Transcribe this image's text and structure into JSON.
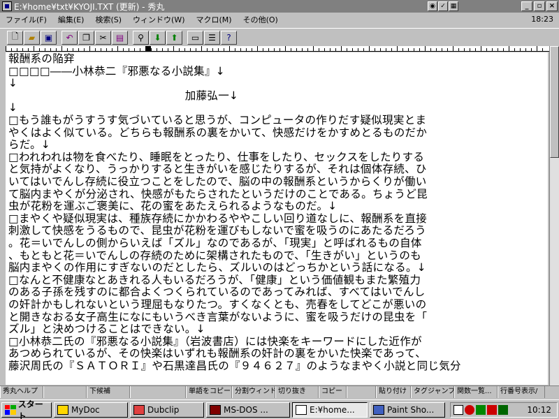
{
  "window": {
    "title": "E:¥home¥txt¥KYOJI.TXT (更新) - 秀丸",
    "tray_icons": [
      "globe-icon",
      "check-icon",
      "grid-icon"
    ],
    "minimize": "_",
    "restore": "▫",
    "close": "×"
  },
  "menu": {
    "items": [
      "ファイル(F)",
      "編集(E)",
      "検索(S)",
      "ウィンドウ(W)",
      "マクロ(M)",
      "その他(O)"
    ],
    "clock": "18:23"
  },
  "toolbar": {
    "buttons": [
      "new-file-icon",
      "open-file-icon",
      "save-icon",
      "undo-icon",
      "copy-icon",
      "cut-icon",
      "paste-icon",
      "search-icon",
      "search-down-icon",
      "search-up-icon",
      "tag-jump-icon",
      "split-window-icon",
      "help-icon"
    ]
  },
  "document": {
    "lines": [
      "報酬系の陥穽",
      "□□□□――小林恭二『邪悪なる小説集』↓",
      "↓",
      "　　　　　　　　　　　　　　　　加藤弘一↓",
      "↓",
      "□もう誰もがうすうす気づいていると思うが、コンピュータの作りだす疑似現実とま",
      "やくはよく似ている。どちらも報酬系の裏をかいて、快感だけをかすめとるものだか",
      "らだ。↓",
      "□われわれは物を食べたり、睡眠をとったり、仕事をしたり、セックスをしたりする",
      "と気持がよくなり、うっかりすると生きがいを感じたりするが、それは個体存続、ひ",
      "いてはいでんし存続に役立つことをしたので、脳の中の報酬系というからくりが働い",
      "て脳内まやくが分泌され、快感がもたらされたというだけのことである。ちょうど昆",
      "虫が花粉を運ぶご褒美に、花の蜜をあたえられるようなものだ。↓",
      "□まやくや疑似現実は、種族存続にかかわるややこしい回り道なしに、報酬系を直接",
      "刺激して快感をうるもので、昆虫が花粉を運びもしないで蜜を吸うのにあたるだろう",
      "。花＝いでんしの側からいえば「ズル」なのであるが、「現実」と呼ばれるもの自体",
      "、もともと花＝いでんしの存続のために架構されたもので、「生きがい」というのも",
      "脳内まやくの作用にすぎないのだとしたら、ズルいのはどっちかという話になる。↓",
      "□なんと不健康なとあきれる人もいるだろうが、「健康」という価値観もまた繁殖力",
      "のある子孫を残すのに都合よくつくられているのであってみれば、すべてはいでんし",
      "の奸計かもしれないという理屈もなりたつ。すくなくとも、売春をしてどこが悪いの",
      "と開きなおる女子高生になにもいうべき言葉がないように、蜜を吸うだけの昆虫を「",
      "ズル」と決めつけることはできない。↓",
      "□小林恭二氏の『邪悪なる小説集』（岩波書店）には快楽をキーワードにした近作が",
      "あつめられているが、その快楽はいずれも報酬系の奸計の裏をかいた快楽であって、",
      "藤沢周氏の『ＳＡＴＯＲＩ』や石黒達昌氏の『９４６２７』のようなまやく小説と同じ気分"
    ]
  },
  "function_keys": [
    "秀丸ヘルプ",
    "",
    "下候補",
    "",
    "単語をコピー",
    "分割ウィンドウ",
    "切り抜き",
    "コピー",
    "",
    "貼り付け",
    "タグジャンプ",
    "関数一覧...",
    "行番号表示/"
  ],
  "taskbar": {
    "start": "スタート",
    "buttons": [
      {
        "label": "MyDoc",
        "icon": "folder-icon"
      },
      {
        "label": "Dubclip",
        "icon": "clipboard-icon"
      },
      {
        "label": "MS-DOS ...",
        "icon": "msdos-icon"
      },
      {
        "label": "E:¥home...",
        "icon": "hidemaru-icon"
      },
      {
        "label": "Paint Sho...",
        "icon": "paint-icon"
      }
    ],
    "active_index": 3,
    "time": "10:12"
  }
}
